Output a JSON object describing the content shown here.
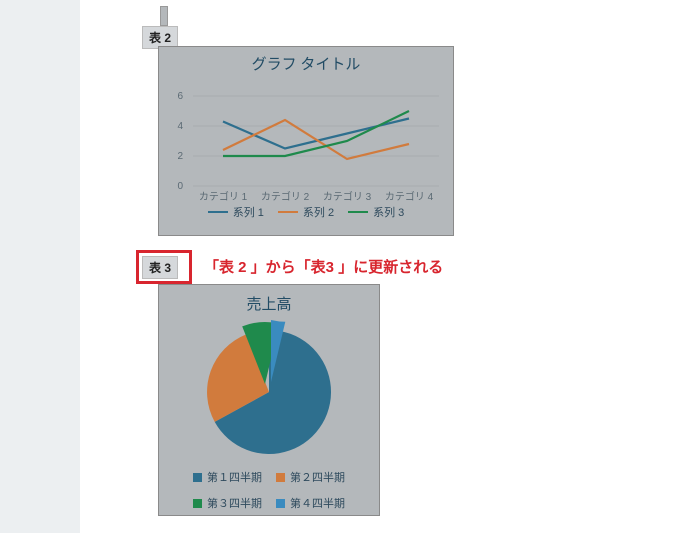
{
  "labels": {
    "fig2": "表 2",
    "fig3": "表 3"
  },
  "annotation": "「表 2 」から「表3 」に更新される",
  "chart_data": [
    {
      "type": "line",
      "title": "グラフ タイトル",
      "categories": [
        "カテゴリ 1",
        "カテゴリ 2",
        "カテゴリ 3",
        "カテゴリ 4"
      ],
      "series": [
        {
          "name": "系列 1",
          "color": "#2e6f8e",
          "values": [
            4.3,
            2.5,
            3.5,
            4.5
          ]
        },
        {
          "name": "系列 2",
          "color": "#d17b3d",
          "values": [
            2.4,
            4.4,
            1.8,
            2.8
          ]
        },
        {
          "name": "系列 3",
          "color": "#1f8a4c",
          "values": [
            2.0,
            2.0,
            3.0,
            5.0
          ]
        }
      ],
      "ylim": [
        0,
        7
      ],
      "yticks": [
        0,
        2,
        4,
        6
      ],
      "xlabel": "",
      "ylabel": "",
      "legend_pos": "bottom",
      "grid": "horizontal"
    },
    {
      "type": "pie",
      "title": "売上高",
      "slices": [
        {
          "name": "第１四半期",
          "color": "#2e6f8e",
          "value": 58
        },
        {
          "name": "第２四半期",
          "color": "#d17b3d",
          "value": 23
        },
        {
          "name": "第３四半期",
          "color": "#1f8a4c",
          "value": 10
        },
        {
          "name": "第４四半期",
          "color": "#3a8bbf",
          "value": 9
        }
      ],
      "legend_pos": "bottom"
    }
  ]
}
